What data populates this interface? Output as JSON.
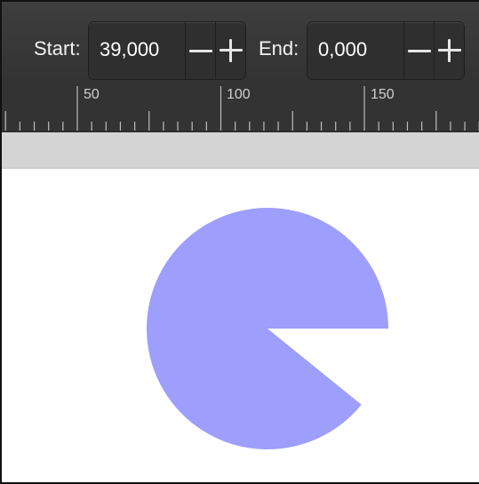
{
  "toolbar": {
    "start_label": "Start:",
    "start_value": "39,000",
    "end_label": "End:",
    "end_value": "0,000"
  },
  "ruler": {
    "labels": [
      "50",
      "100",
      "150"
    ]
  },
  "shape": {
    "type": "pie-wedge",
    "fill_color": "#9e9efc",
    "start_angle": 39,
    "end_angle": 0
  },
  "colors": {
    "toolbar": "#383838",
    "ruler": "#333333",
    "gutter": "#d4d4d4",
    "canvas": "#ffffff"
  }
}
